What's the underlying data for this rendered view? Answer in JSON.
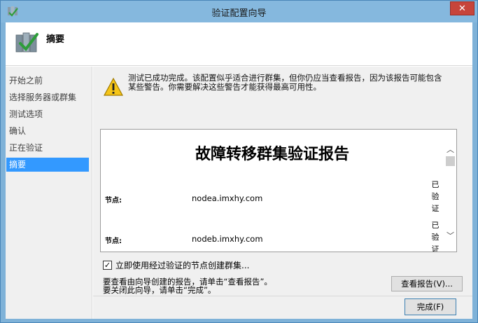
{
  "window": {
    "title": "验证配置向导",
    "close_label": "✕"
  },
  "header": {
    "title": "摘要"
  },
  "nav": {
    "items": [
      {
        "label": "开始之前"
      },
      {
        "label": "选择服务器或群集"
      },
      {
        "label": "测试选项"
      },
      {
        "label": "确认"
      },
      {
        "label": "正在验证"
      },
      {
        "label": "摘要"
      }
    ],
    "active_index": 5
  },
  "warning": {
    "line1": "测试已成功完成。该配置似乎适合进行群集，但你仍应当查看报告，因为该报告可能包含",
    "line2": "某些警告。你需要解决这些警告才能获得最高可用性。"
  },
  "report": {
    "title": "故障转移群集验证报告",
    "nodes": [
      {
        "label": "节点:",
        "value": "nodea.imxhy.com",
        "status": [
          "已",
          "验",
          "证"
        ]
      },
      {
        "label": "节点:",
        "value": "nodeb.imxhy.com",
        "status": [
          "已",
          "验",
          "证"
        ]
      }
    ]
  },
  "checkbox": {
    "label": "立即使用经过验证的节点创建群集...",
    "checked": true,
    "mark": "✓"
  },
  "hint": {
    "line1": "要查看由向导创建的报告，请单击“查看报告”。",
    "line2": "要关闭此向导，请单击“完成”。"
  },
  "buttons": {
    "view_report": "查看报告(V)...",
    "finish": "完成(F)"
  },
  "icons": {
    "scroll_up": "︿",
    "scroll_down": "﹀"
  },
  "colors": {
    "title_bar": "#85b8de",
    "close_button": "#c7453b",
    "nav_active": "#3399ff",
    "warning_yellow": "#f5c518"
  }
}
